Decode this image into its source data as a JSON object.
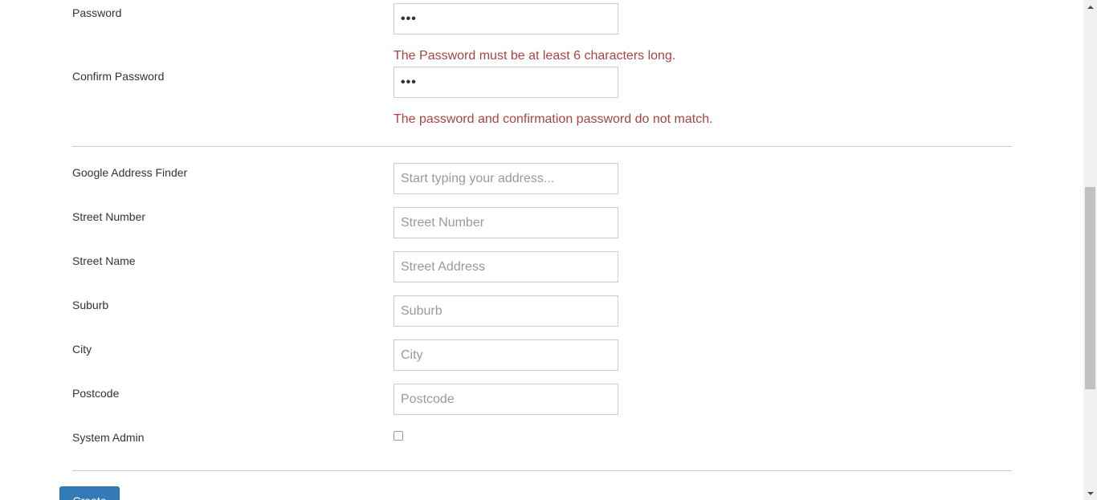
{
  "form": {
    "password": {
      "label": "Password",
      "value": "•••",
      "error": "The Password must be at least 6 characters long."
    },
    "confirm_password": {
      "label": "Confirm Password",
      "value": "•••",
      "error": "The password and confirmation password do not match."
    },
    "google_address": {
      "label": "Google Address Finder",
      "placeholder": "Start typing your address..."
    },
    "street_number": {
      "label": "Street Number",
      "placeholder": "Street Number"
    },
    "street_name": {
      "label": "Street Name",
      "placeholder": "Street Address"
    },
    "suburb": {
      "label": "Suburb",
      "placeholder": "Suburb"
    },
    "city": {
      "label": "City",
      "placeholder": "City"
    },
    "postcode": {
      "label": "Postcode",
      "placeholder": "Postcode"
    },
    "system_admin": {
      "label": "System Admin",
      "checked": false
    }
  },
  "actions": {
    "submit_label": "Create"
  },
  "colors": {
    "error": "#a94442",
    "primary": "#337ab7",
    "border": "#cccccc"
  },
  "scrollbar": {
    "position_fraction": 0.62
  }
}
